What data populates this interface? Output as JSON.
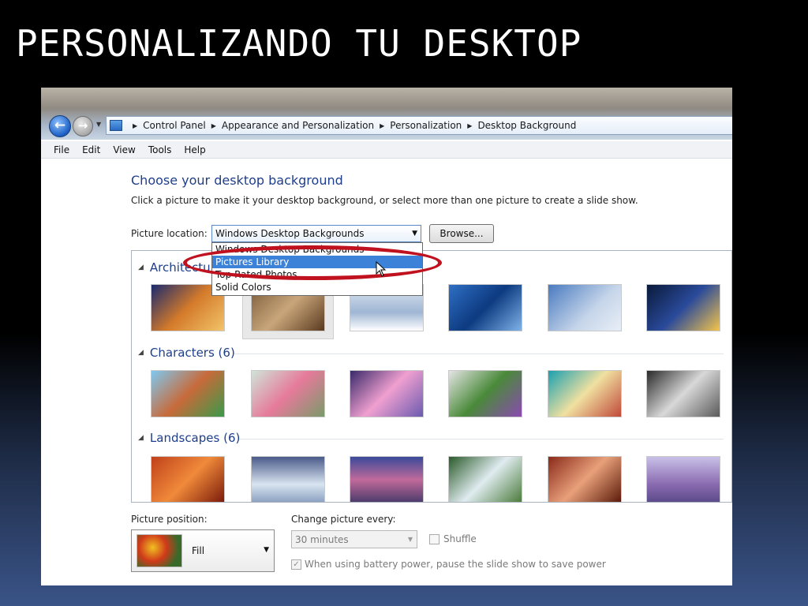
{
  "slide": {
    "title": "PERSONALIZANDO TU DESKTOP"
  },
  "address": {
    "crumbs": [
      "Control Panel",
      "Appearance and Personalization",
      "Personalization",
      "Desktop Background"
    ]
  },
  "menu": {
    "items": [
      "File",
      "Edit",
      "View",
      "Tools",
      "Help"
    ]
  },
  "content": {
    "heading": "Choose your desktop background",
    "subtext": "Click a picture to make it your desktop background, or select more than one picture to create a slide show.",
    "picture_location_label": "Picture location:",
    "picture_location_value": "Windows Desktop Backgrounds",
    "browse_label": "Browse...",
    "dropdown_options": [
      "Windows Desktop Backgrounds",
      "Pictures Library",
      "Top Rated Photos",
      "Solid Colors"
    ],
    "dropdown_highlighted": "Pictures Library"
  },
  "gallery": {
    "groups": [
      {
        "label": "Architecture (6)",
        "visible_label": "Architectur"
      },
      {
        "label": "Characters (6)"
      },
      {
        "label": "Landscapes (6)"
      }
    ]
  },
  "options": {
    "picture_position_label": "Picture position:",
    "picture_position_value": "Fill",
    "change_every_label": "Change picture every:",
    "change_every_value": "30 minutes",
    "shuffle_label": "Shuffle",
    "battery_label": "When using battery power, pause the slide show to save power"
  },
  "colors": {
    "accent_blue": "#1e3e8a",
    "highlight": "#3b82d8",
    "annotation_red": "#c0121e"
  }
}
